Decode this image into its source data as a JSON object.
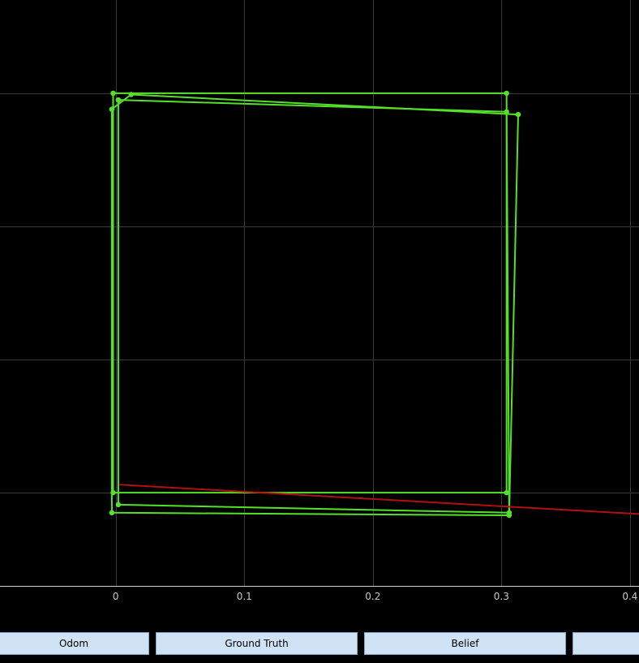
{
  "colors": {
    "background": "#000000",
    "grid": "#3a3a3a",
    "axis": "#d0d0d0",
    "path": "#55e12a",
    "red_path": "#b01010",
    "button_fill": "#cfe3f5",
    "button_border": "#7fa7cf"
  },
  "buttons": {
    "odom": "Odom",
    "ground_truth": "Ground Truth",
    "belief": "Belief",
    "extra": ""
  },
  "chart_data": {
    "type": "line",
    "title": "",
    "xlabel": "",
    "ylabel": "",
    "x_ticks": [
      "0",
      "0.1",
      "0.2",
      "0.3",
      "0.4"
    ],
    "x_tick_values": [
      0,
      0.1,
      0.2,
      0.3,
      0.4
    ],
    "xlim": [
      -0.09,
      0.407
    ],
    "ylim": [
      -0.07,
      0.37
    ],
    "y_grid_values": [
      -0.3,
      0,
      0.1,
      0.2,
      0.3
    ],
    "grid": true,
    "series": [
      {
        "color": "#55e12a",
        "markers": true,
        "points": [
          [
            -0.002,
            0.3
          ],
          [
            0.304,
            0.3
          ],
          [
            0.304,
            0.0
          ],
          [
            -0.002,
            0.0
          ],
          [
            -0.002,
            0.3
          ]
        ]
      },
      {
        "color": "#55e12a",
        "markers": true,
        "points": [
          [
            0.002,
            0.295
          ],
          [
            0.304,
            0.286
          ],
          [
            0.306,
            -0.015
          ],
          [
            0.002,
            -0.009
          ],
          [
            0.002,
            0.295
          ]
        ]
      },
      {
        "color": "#55e12a",
        "markers": true,
        "points": [
          [
            -0.003,
            0.288
          ],
          [
            0.012,
            0.299
          ],
          [
            0.313,
            0.284
          ],
          [
            0.306,
            -0.017
          ],
          [
            -0.003,
            -0.015
          ],
          [
            -0.003,
            0.288
          ]
        ]
      },
      {
        "color": "#b01010",
        "markers": false,
        "points": [
          [
            0.003,
            0.006
          ],
          [
            0.407,
            -0.016
          ]
        ]
      }
    ]
  }
}
